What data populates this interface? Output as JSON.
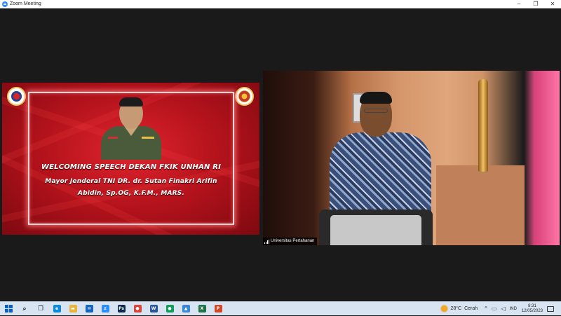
{
  "window": {
    "title": "Zoom Meeting",
    "controls": {
      "minimize": "–",
      "maximize": "❐",
      "close": "✕"
    }
  },
  "slide": {
    "heading": "WELCOMING SPEECH DEKAN FKIK UNHAN RI",
    "subtitle_line1": "Mayor Jenderal TNI DR. dr. Sutan Finakri Arifin",
    "subtitle_line2": "Abidin, Sp.OG, K.F.M., MARS."
  },
  "video": {
    "participant_name": "Universitas Pertahanan"
  },
  "taskbar": {
    "apps": [
      {
        "name": "search-icon",
        "glyph": "⌕",
        "color": "#1f1f1f"
      },
      {
        "name": "task-view-icon",
        "glyph": "❐",
        "color": "#1f1f1f"
      },
      {
        "name": "edge-icon",
        "glyph": "e",
        "color": "#0f8ad8"
      },
      {
        "name": "file-explorer-icon",
        "glyph": "▬",
        "color": "#e8b43a"
      },
      {
        "name": "mail-icon",
        "glyph": "✉",
        "color": "#1565c0"
      },
      {
        "name": "zoom-icon",
        "glyph": "z",
        "color": "#2d8cff"
      },
      {
        "name": "photoshop-icon",
        "glyph": "Ps",
        "color": "#0b2a4a"
      },
      {
        "name": "chrome-icon",
        "glyph": "●",
        "color": "#db4437"
      },
      {
        "name": "word-icon",
        "glyph": "W",
        "color": "#2b579a"
      },
      {
        "name": "chrome-profile-icon",
        "glyph": "●",
        "color": "#0f9d58"
      },
      {
        "name": "photos-icon",
        "glyph": "▲",
        "color": "#3a87d8"
      },
      {
        "name": "excel-icon",
        "glyph": "X",
        "color": "#217346"
      },
      {
        "name": "powerpoint-icon",
        "glyph": "P",
        "color": "#d24726"
      }
    ],
    "weather": {
      "temp": "28°C",
      "condition": "Cerah"
    },
    "tray": {
      "chevron": "^",
      "network": "▭",
      "volume": "◁",
      "language": "IND"
    },
    "clock": {
      "time": "8:31",
      "date": "12/05/2023"
    }
  }
}
